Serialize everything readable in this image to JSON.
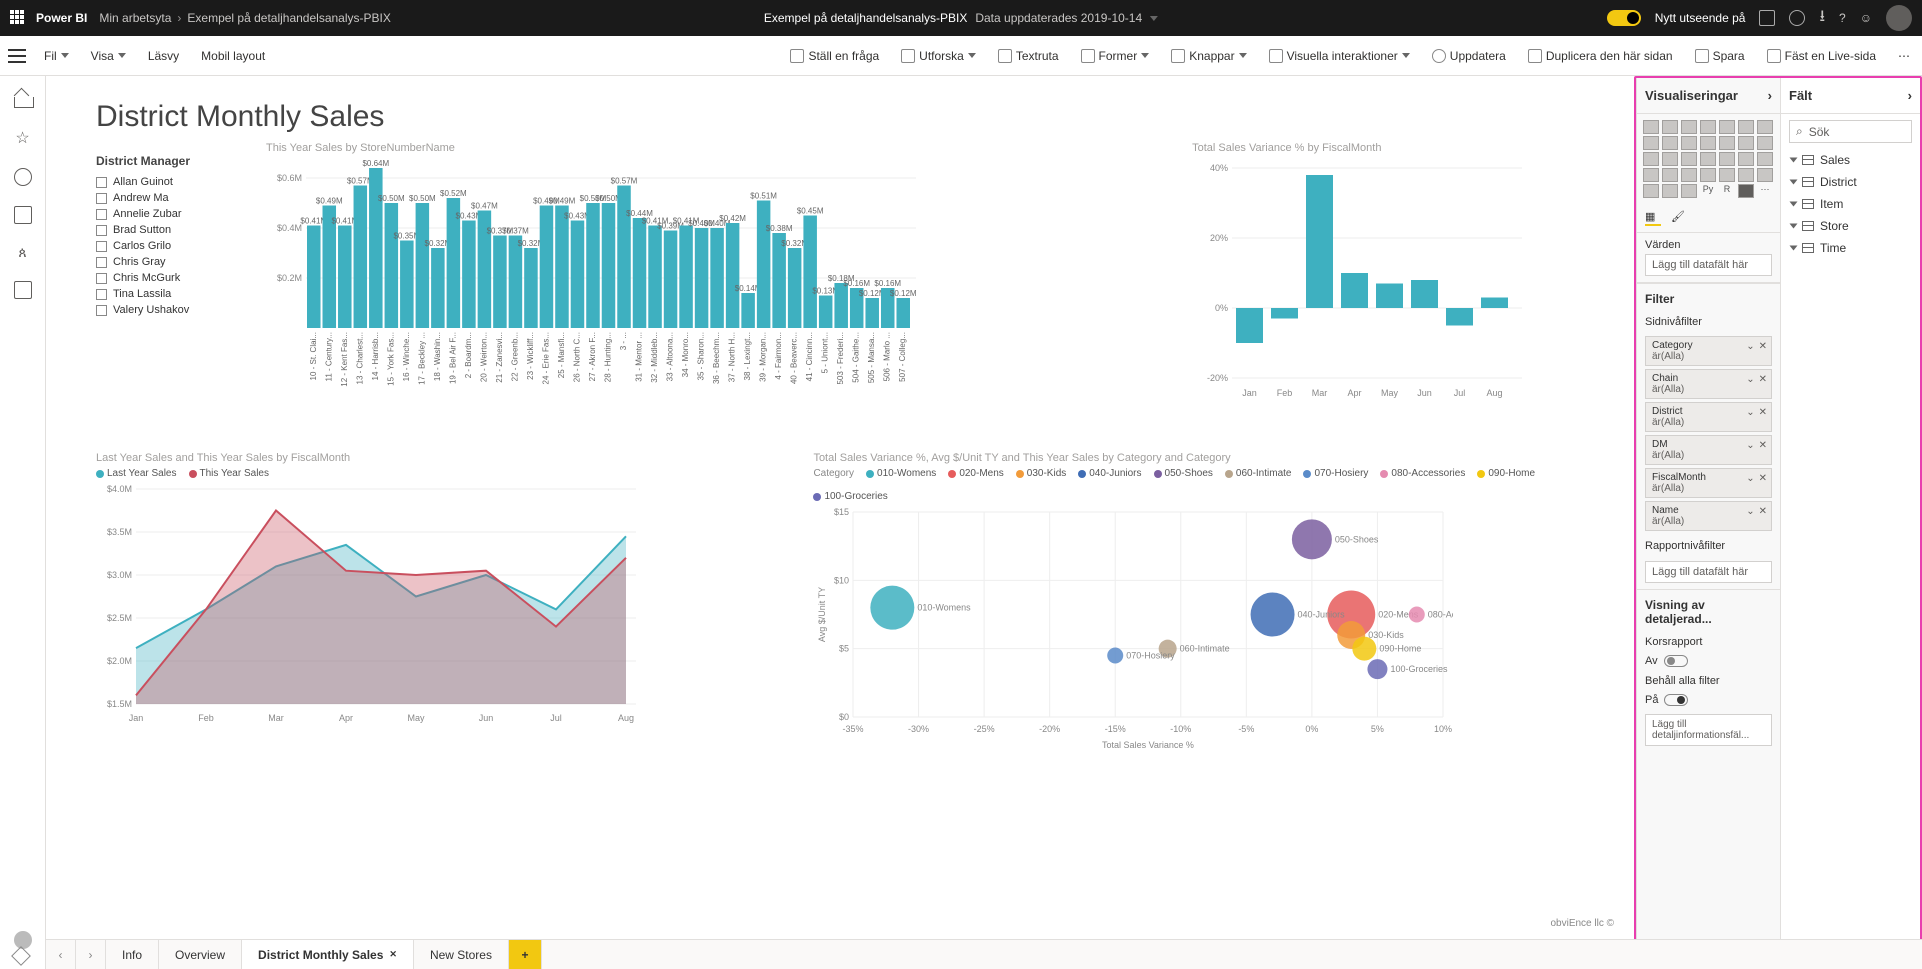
{
  "topbar": {
    "brand": "Power BI",
    "workspace": "Min arbetsyta",
    "file": "Exempel på detaljhandelsanalys-PBIX",
    "center_name": "Exempel på detaljhandelsanalys-PBIX",
    "updated": "Data uppdaterades 2019-10-14",
    "toggle_label": "Nytt utseende på"
  },
  "ribbon": {
    "file": "Fil",
    "view": "Visa",
    "reading_view": "Läsvy",
    "mobile": "Mobil layout",
    "ask": "Ställ en fråga",
    "explore": "Utforska",
    "textbox": "Textruta",
    "shapes": "Former",
    "buttons": "Knappar",
    "visual_interactions": "Visuella interaktioner",
    "refresh": "Uppdatera",
    "duplicate": "Duplicera den här sidan",
    "save": "Spara",
    "pin": "Fäst en Live-sida"
  },
  "title": "District Monthly Sales",
  "slicer": {
    "title": "District Manager",
    "items": [
      "Allan Guinot",
      "Andrew Ma",
      "Annelie Zubar",
      "Brad Sutton",
      "Carlos Grilo",
      "Chris Gray",
      "Chris McGurk",
      "Tina Lassila",
      "Valery Ushakov"
    ]
  },
  "chart_data": [
    {
      "id": "bar1",
      "type": "bar",
      "title": "This Year Sales by StoreNumberName",
      "ylabel": "",
      "ylim": [
        0,
        0.6
      ],
      "yticks": [
        "$0.2M",
        "$0.4M",
        "$0.6M"
      ],
      "categories": [
        "10 - St. Clai...",
        "11 - Century...",
        "12 - Kent Fas...",
        "13 - Charlest...",
        "14 - Harrisb...",
        "15 - York Fas...",
        "16 - Winche...",
        "17 - Beckley ...",
        "18 - Washin...",
        "19 - Bel Air F...",
        "2 - Boardm...",
        "20 - Weirton...",
        "21 - Zanesvi...",
        "22 - Greenb...",
        "23 - Wickliff...",
        "24 - Erie Fas...",
        "25 - Mansfi...",
        "26 - North C...",
        "27 - Akron F...",
        "28 - Hunting...",
        "3 - ...",
        "31 - Mentor ...",
        "32 - Middleb...",
        "33 - Altoona...",
        "34 - Monro...",
        "35 - Sharon...",
        "36 - Beechm...",
        "37 - North H...",
        "38 - Lexingt...",
        "39 - Morgan...",
        "4 - Fairmon...",
        "40 - Beaverc...",
        "41 - Cincinn...",
        "5 - Uniont...",
        "503 - Frederi...",
        "504 - Gaithe...",
        "505 - Mansa...",
        "506 - Marlo ...",
        "507 - Colleg..."
      ],
      "values": [
        0.41,
        0.49,
        0.41,
        0.57,
        0.64,
        0.5,
        0.35,
        0.5,
        0.32,
        0.52,
        0.43,
        0.47,
        0.37,
        0.37,
        0.32,
        0.49,
        0.49,
        0.43,
        0.5,
        0.5,
        0.57,
        0.44,
        0.41,
        0.39,
        0.41,
        0.4,
        0.4,
        0.42,
        0.14,
        0.51,
        0.38,
        0.32,
        0.45,
        0.13,
        0.18,
        0.16,
        0.12,
        0.16,
        0.12
      ]
    },
    {
      "id": "bar2",
      "type": "bar",
      "title": "Total Sales Variance % by FiscalMonth",
      "ylim": [
        -0.2,
        0.4
      ],
      "yticks": [
        "-20%",
        "0%",
        "20%",
        "40%"
      ],
      "categories": [
        "Jan",
        "Feb",
        "Mar",
        "Apr",
        "May",
        "Jun",
        "Jul",
        "Aug"
      ],
      "values": [
        -0.1,
        -0.03,
        0.38,
        0.1,
        0.07,
        0.08,
        -0.05,
        0.03
      ]
    },
    {
      "id": "area",
      "type": "area",
      "title": "Last Year Sales and This Year Sales by FiscalMonth",
      "ylim": [
        1.5,
        4.0
      ],
      "yticks": [
        "$1.5M",
        "$2.0M",
        "$2.5M",
        "$3.0M",
        "$3.5M",
        "$4.0M"
      ],
      "categories": [
        "Jan",
        "Feb",
        "Mar",
        "Apr",
        "May",
        "Jun",
        "Jul",
        "Aug"
      ],
      "series": [
        {
          "name": "Last Year Sales",
          "color": "#3eb0c0",
          "values": [
            2.15,
            2.6,
            3.1,
            3.35,
            2.75,
            3.0,
            2.6,
            3.45
          ]
        },
        {
          "name": "This Year Sales",
          "color": "#c94f5e",
          "values": [
            1.6,
            2.6,
            3.75,
            3.05,
            3.0,
            3.05,
            2.4,
            3.2
          ]
        }
      ]
    },
    {
      "id": "bubble",
      "type": "scatter",
      "title": "Total Sales Variance %, Avg $/Unit TY and This Year Sales by Category and Category",
      "xlabel": "Total Sales Variance %",
      "ylabel": "Avg $/Unit TY",
      "xlim": [
        -0.35,
        0.1
      ],
      "ylim": [
        0,
        15
      ],
      "xticks": [
        "-35%",
        "-30%",
        "-25%",
        "-20%",
        "-15%",
        "-10%",
        "-5%",
        "0%",
        "5%",
        "10%"
      ],
      "yticks": [
        "$0",
        "$5",
        "$10",
        "$15"
      ],
      "legend_label": "Category",
      "series": [
        {
          "name": "010-Womens",
          "color": "#3eb0c0",
          "x": -0.32,
          "y": 8.0,
          "r": 22
        },
        {
          "name": "020-Mens",
          "color": "#e65c5c",
          "x": 0.03,
          "y": 7.5,
          "r": 24
        },
        {
          "name": "030-Kids",
          "color": "#f29b3a",
          "x": 0.03,
          "y": 6.0,
          "r": 14
        },
        {
          "name": "040-Juniors",
          "color": "#3f6db5",
          "x": -0.03,
          "y": 7.5,
          "r": 22
        },
        {
          "name": "050-Shoes",
          "color": "#7b5fa0",
          "x": 0.0,
          "y": 13.0,
          "r": 20
        },
        {
          "name": "060-Intimate",
          "color": "#b8a58c",
          "x": -0.11,
          "y": 5.0,
          "r": 9
        },
        {
          "name": "070-Hosiery",
          "color": "#5a8bc9",
          "x": -0.15,
          "y": 4.5,
          "r": 8
        },
        {
          "name": "080-Accessories",
          "color": "#e58bb0",
          "x": 0.08,
          "y": 7.5,
          "r": 8
        },
        {
          "name": "090-Home",
          "color": "#f2c811",
          "x": 0.04,
          "y": 5.0,
          "r": 12
        },
        {
          "name": "100-Groceries",
          "color": "#6b6bb5",
          "x": 0.05,
          "y": 3.5,
          "r": 10
        }
      ]
    }
  ],
  "viz_pane": {
    "title": "Visualiseringar",
    "values_label": "Värden",
    "add_field": "Lägg till datafält här",
    "filter_label": "Filter",
    "page_filters_label": "Sidnivåfilter",
    "filters": [
      {
        "name": "Category",
        "value": "är(Alla)"
      },
      {
        "name": "Chain",
        "value": "är(Alla)"
      },
      {
        "name": "District",
        "value": "är(Alla)"
      },
      {
        "name": "DM",
        "value": "är(Alla)"
      },
      {
        "name": "FiscalMonth",
        "value": "är(Alla)"
      },
      {
        "name": "Name",
        "value": "är(Alla)"
      }
    ],
    "report_filters_label": "Rapportnivåfilter",
    "drillthrough_label": "Visning av detaljerad...",
    "cross_report": "Korsrapport",
    "off": "Av",
    "keep_filters": "Behåll alla filter",
    "on": "På",
    "add_drill": "Lägg till detaljinformationsfäl..."
  },
  "fields_pane": {
    "title": "Fält",
    "search": "Sök",
    "tables": [
      "Sales",
      "District",
      "Item",
      "Store",
      "Time"
    ]
  },
  "tabs": {
    "items": [
      "Info",
      "Overview",
      "District Monthly Sales",
      "New Stores"
    ],
    "active": 2
  },
  "footer_credit": "obviEnce llc ©"
}
